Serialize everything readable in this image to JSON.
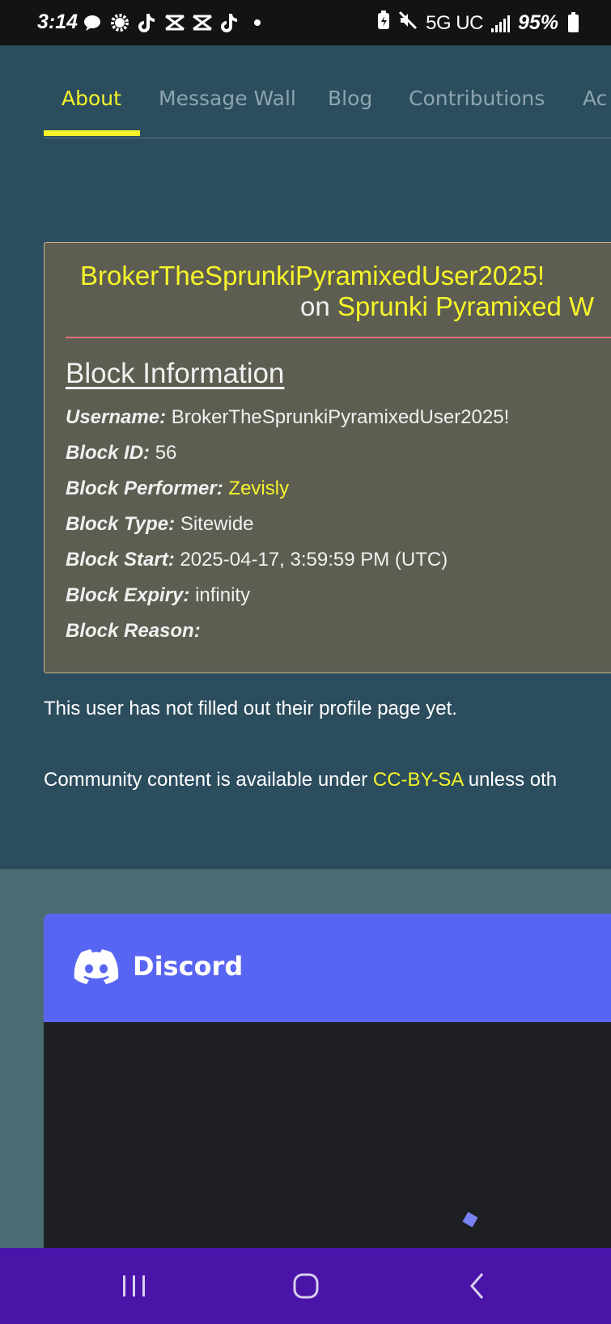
{
  "status_bar": {
    "time": "3:14",
    "network": "5G UC",
    "battery": "95%"
  },
  "tabs": [
    {
      "label": "About",
      "active": true
    },
    {
      "label": "Message Wall",
      "active": false
    },
    {
      "label": "Blog",
      "active": false
    },
    {
      "label": "Contributions",
      "active": false
    },
    {
      "label": "Ac",
      "active": false
    }
  ],
  "block": {
    "title_user": "BrokerTheSprunkiPyramixedUser2025!",
    "title_on": "on",
    "title_wiki": "Sprunki Pyramixed W",
    "heading": "Block Information",
    "rows": [
      {
        "label": "Username:",
        "value": "BrokerTheSprunkiPyramixedUser2025!"
      },
      {
        "label": "Block ID:",
        "value": "56"
      },
      {
        "label": "Block Performer:",
        "value": "Zevisly"
      },
      {
        "label": "Block Type:",
        "value": "Sitewide"
      },
      {
        "label": "Block Start:",
        "value": "2025-04-17, 3:59:59 PM (UTC)"
      },
      {
        "label": "Block Expiry:",
        "value": "infinity"
      },
      {
        "label": "Block Reason:",
        "value": ""
      }
    ]
  },
  "profile_note": "This user has not filled out their profile page yet.",
  "license": {
    "prefix": "Community content is available under ",
    "link": "CC-BY-SA",
    "suffix": " unless oth"
  },
  "discord": {
    "label": "Discord",
    "brand_color": "#5865f2"
  },
  "colors": {
    "accent": "#f5f52a",
    "page_bg": "#2c4d5e",
    "box_bg": "#5e5d52",
    "nav_bg": "#4a14a8"
  }
}
